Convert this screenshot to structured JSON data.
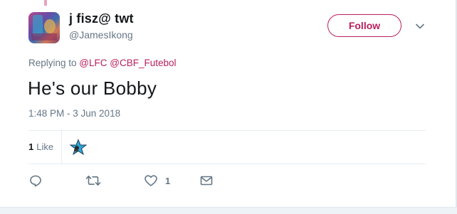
{
  "user": {
    "display_name": "j fisz@ twt",
    "screen_name": "@JamesIkong"
  },
  "header": {
    "follow_label": "Follow"
  },
  "reply": {
    "prefix": "Replying to ",
    "mention_1": "@LFC",
    "mention_2": "@CBF_Futebol"
  },
  "tweet": {
    "text": "He's our Bobby",
    "timestamp": "1:48 PM - 3 Jun 2018"
  },
  "stats": {
    "like_count": "1",
    "like_label": "Like"
  },
  "actions": {
    "like_count": "1"
  },
  "colors": {
    "accent": "#b81f5d",
    "secondary_text": "#657786",
    "primary_text": "#14171a",
    "divider": "#e6ecf0"
  },
  "icons": {
    "caret": "chevron-down-icon",
    "reply": "reply-icon",
    "retweet": "retweet-icon",
    "like": "heart-icon",
    "dm": "envelope-icon"
  }
}
